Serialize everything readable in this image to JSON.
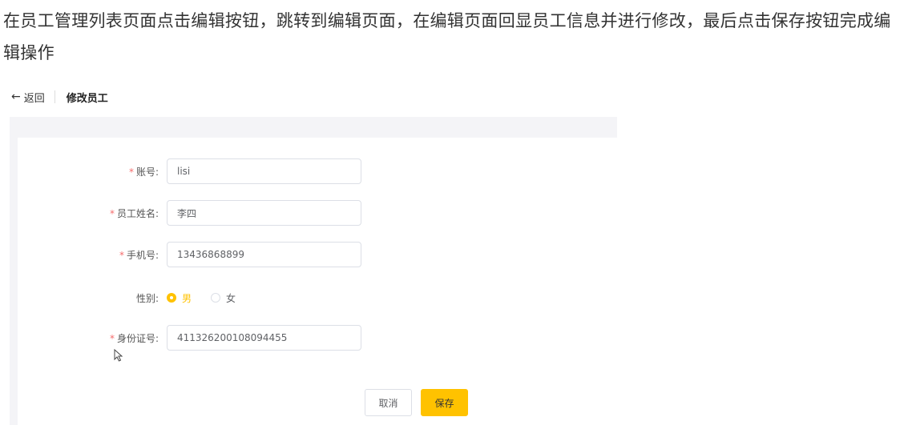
{
  "intro_text": "在员工管理列表页面点击编辑按钮，跳转到编辑页面，在编辑页面回显员工信息并进行修改，最后点击保存按钮完成编辑操作",
  "header": {
    "back_label": "返回",
    "title": "修改员工"
  },
  "form": {
    "account": {
      "label": "账号:",
      "value": "lisi"
    },
    "name": {
      "label": "员工姓名:",
      "value": "李四"
    },
    "phone": {
      "label": "手机号:",
      "value": "13436868899"
    },
    "gender": {
      "label": "性别:",
      "options": [
        "男",
        "女"
      ],
      "selected": "男"
    },
    "id_number": {
      "label": "身份证号:",
      "value": "411326200108094455"
    }
  },
  "buttons": {
    "cancel": "取消",
    "save": "保存"
  },
  "colors": {
    "accent": "#ffc200",
    "required": "#f56c6c"
  }
}
